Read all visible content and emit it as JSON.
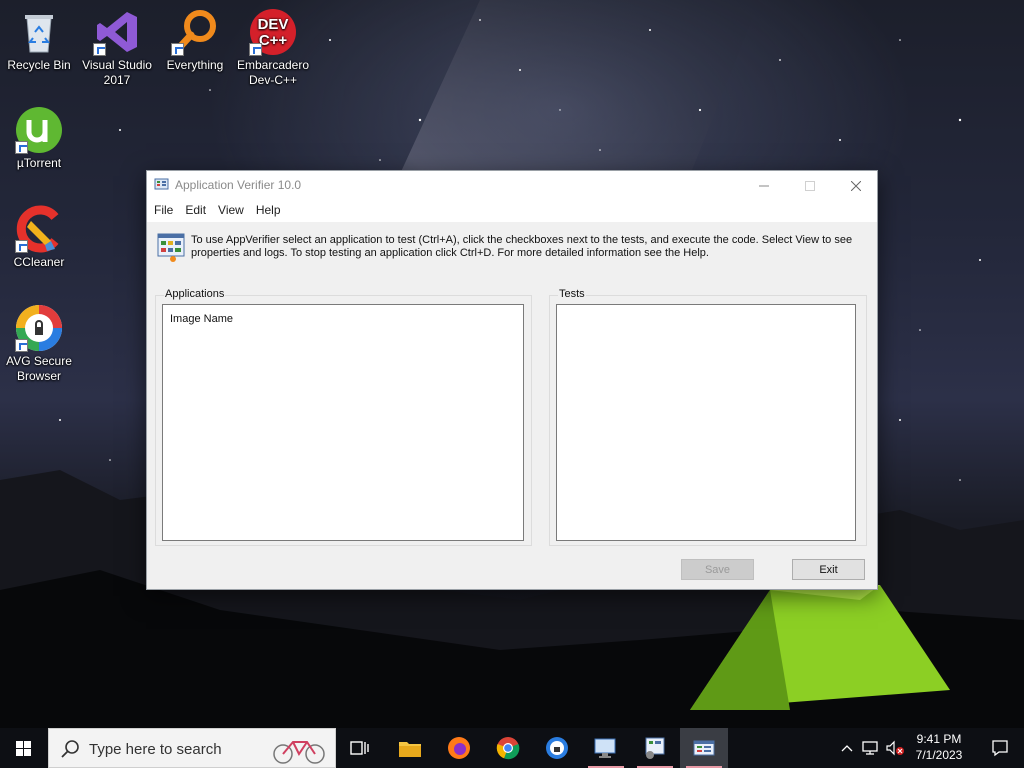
{
  "desktop": {
    "icons": [
      {
        "label": "Recycle Bin",
        "icon": "recycle-bin-icon"
      },
      {
        "label": "Visual Studio 2017",
        "icon": "visual-studio-icon"
      },
      {
        "label": "Everything",
        "icon": "everything-search-icon"
      },
      {
        "label": "Embarcadero Dev-C++",
        "icon": "dev-cpp-icon"
      },
      {
        "label": "µTorrent",
        "icon": "utorrent-icon"
      },
      {
        "label": "CCleaner",
        "icon": "ccleaner-icon"
      },
      {
        "label": "AVG Secure Browser",
        "icon": "avg-browser-icon"
      }
    ],
    "devcpp_logo_line1": "DEV",
    "devcpp_logo_line2": "C++"
  },
  "window": {
    "title": "Application Verifier 10.0",
    "menu": [
      "File",
      "Edit",
      "View",
      "Help"
    ],
    "info_text": "To use AppVerifier select an application to test (Ctrl+A), click the checkboxes next to the tests, and execute the code. Select View to see properties and logs. To stop testing an application click Ctrl+D. For more detailed information see the Help.",
    "applications": {
      "label": "Applications",
      "column_header": "Image Name"
    },
    "tests": {
      "label": "Tests"
    },
    "buttons": {
      "save": "Save",
      "save_enabled": false,
      "exit": "Exit"
    }
  },
  "taskbar": {
    "search_placeholder": "Type here to search",
    "apps": [
      "task-view-icon",
      "file-explorer-icon",
      "firefox-icon",
      "chrome-icon",
      "avg-browser-icon",
      "remote-desktop-icon",
      "app-verifier-alt-icon",
      "app-verifier-icon"
    ],
    "time": "9:41 PM",
    "date": "7/1/2023"
  },
  "colors": {
    "taskbar": "#0d0f14",
    "window_bg": "#f0f0f0",
    "tent_glow": "#9be62a"
  }
}
